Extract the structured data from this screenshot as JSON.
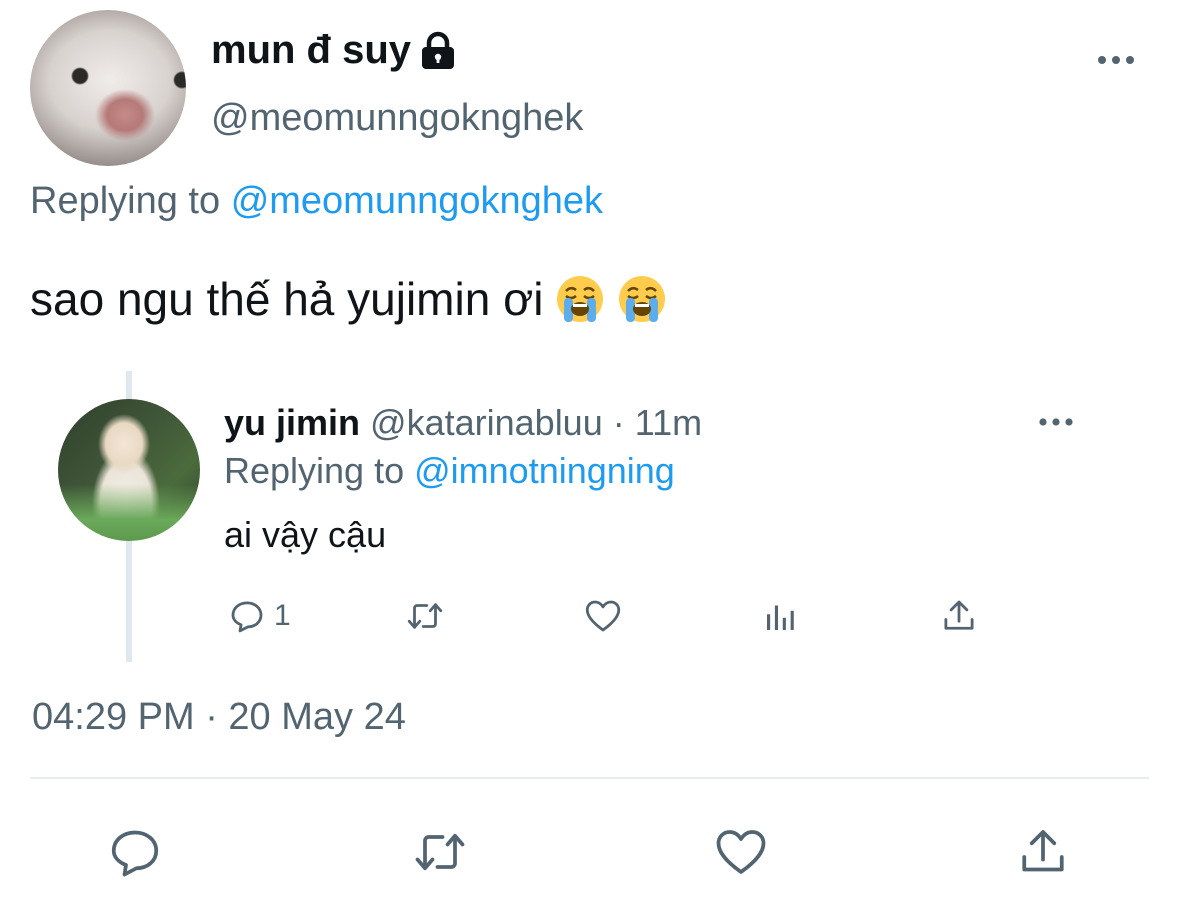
{
  "author": {
    "display_name": "mun đ suy",
    "handle": "@meomunngoknghek"
  },
  "replying": {
    "prefix": "Replying to",
    "to": "@meomunngoknghek"
  },
  "tweet": {
    "text": "sao ngu thế hả yujimin ơi",
    "emojis": [
      "loudly-crying-face",
      "loudly-crying-face"
    ]
  },
  "quoted": {
    "name": "yu jimin",
    "handle": "@katarinabluu",
    "time": "· 11m",
    "reply_prefix": "Replying to",
    "reply_to": "@imnotningning",
    "text": "ai vậy cậu",
    "reply_count": "1"
  },
  "timestamp": "04:29 PM · 20 May 24",
  "colors": {
    "link": "#1d9bf0",
    "secondary": "#536471",
    "primary_text": "#0f1419"
  }
}
